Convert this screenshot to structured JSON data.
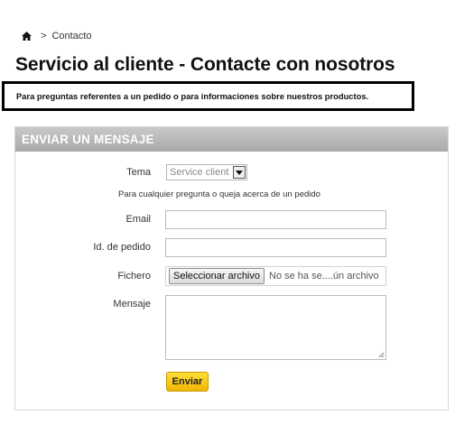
{
  "breadcrumb": {
    "home_icon": "home-icon",
    "separator": ">",
    "current": "Contacto"
  },
  "page": {
    "title": "Servicio al cliente - Contacte con nosotros",
    "notice": "Para preguntas referentes a un pedido o para informaciones sobre nuestros productos."
  },
  "form": {
    "header": "ENVIAR UN MENSAJE",
    "subject_label": "Tema",
    "subject_value": "Service client",
    "subject_hint": "Para cualquier pregunta o queja acerca de un pedido",
    "email_label": "Email",
    "email_value": "",
    "order_label": "Id. de pedido",
    "order_value": "",
    "file_label": "Fichero",
    "file_button": "Seleccionar archivo",
    "file_status": "No se ha se....ún archivo",
    "message_label": "Mensaje",
    "message_value": "",
    "submit_label": "Enviar"
  },
  "colors": {
    "header_bg": "#b3b3b3",
    "submit_bg": "#f6c300",
    "notice_border": "#000000"
  }
}
